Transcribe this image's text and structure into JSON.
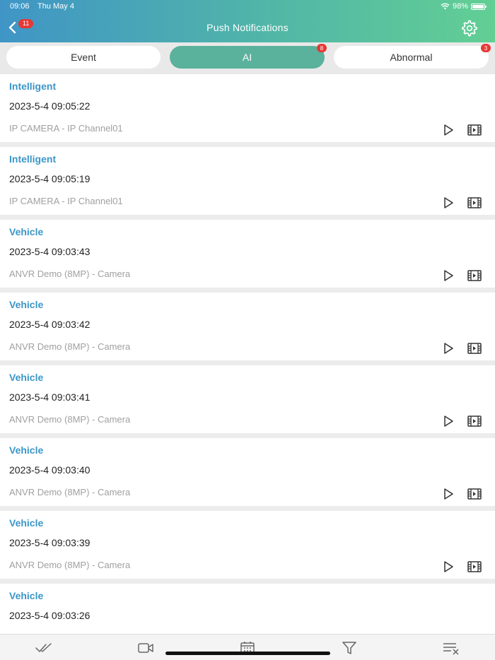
{
  "status_bar": {
    "time": "09:06",
    "date": "Thu May 4",
    "battery": "98%"
  },
  "header": {
    "title": "Push Notifications",
    "back_badge": "11"
  },
  "tabs": [
    {
      "label": "Event",
      "badge": ""
    },
    {
      "label": "AI",
      "badge": "8"
    },
    {
      "label": "Abnormal",
      "badge": "3"
    }
  ],
  "notifications": [
    {
      "type": "Intelligent",
      "time": "2023-5-4 09:05:22",
      "source": "IP CAMERA - IP Channel01"
    },
    {
      "type": "Intelligent",
      "time": "2023-5-4 09:05:19",
      "source": "IP CAMERA - IP Channel01"
    },
    {
      "type": "Vehicle",
      "time": "2023-5-4 09:03:43",
      "source": "ANVR Demo (8MP)  - Camera"
    },
    {
      "type": "Vehicle",
      "time": "2023-5-4 09:03:42",
      "source": "ANVR Demo (8MP)  - Camera"
    },
    {
      "type": "Vehicle",
      "time": "2023-5-4 09:03:41",
      "source": "ANVR Demo (8MP)  - Camera"
    },
    {
      "type": "Vehicle",
      "time": "2023-5-4 09:03:40",
      "source": "ANVR Demo (8MP)  - Camera"
    },
    {
      "type": "Vehicle",
      "time": "2023-5-4 09:03:39",
      "source": "ANVR Demo (8MP)  - Camera"
    },
    {
      "type": "Vehicle",
      "time": "2023-5-4 09:03:26",
      "source": ""
    }
  ],
  "bottom_toolbar": [
    "mark-all-read-icon",
    "video-icon",
    "calendar-icon",
    "filter-icon",
    "clear-list-icon"
  ],
  "colors": {
    "accent": "#5ab19c",
    "type_text": "#3b96c7",
    "badge": "#e53935"
  }
}
